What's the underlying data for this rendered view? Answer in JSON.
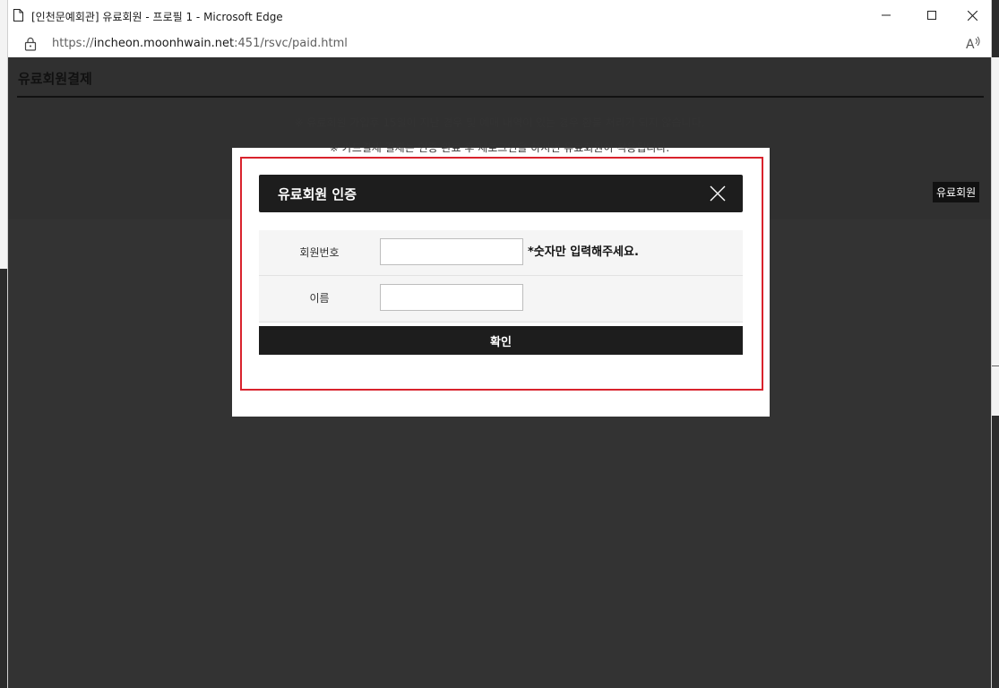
{
  "browser": {
    "window_title": "[인천문예회관] 유료회원 - 프로필 1 - Microsoft Edge",
    "url_prefix": "https://",
    "url_host": "incheon.moonhwain.net",
    "url_rest": ":451/rsvc/paid.html",
    "read_aloud_icon": "A̅⁾"
  },
  "page": {
    "title": "유료회원결제",
    "notice_1": "※ 유료회원 가입후 15일이 지난 경우 및 예매 내역이 있는 경우 환불 처리가 되지 않습니다.",
    "notice_2": "※ 카드결제 결제는 인증 완료 후 재로그인을 하시면 유료회원이 적용됩니다.",
    "paid_button": "유료회원"
  },
  "modal": {
    "title": "유료회원 인증",
    "fields": [
      {
        "label": "회원번호",
        "value": "",
        "placeholder": "",
        "hint": "*숫자만 입력해주세요."
      },
      {
        "label": "이름",
        "value": "",
        "placeholder": ""
      }
    ],
    "confirm_label": "확인"
  },
  "colors": {
    "highlight_border": "#d9232d",
    "header_bg": "#1d1d1d",
    "overlay": "rgba(0,0,0,0.80)"
  }
}
